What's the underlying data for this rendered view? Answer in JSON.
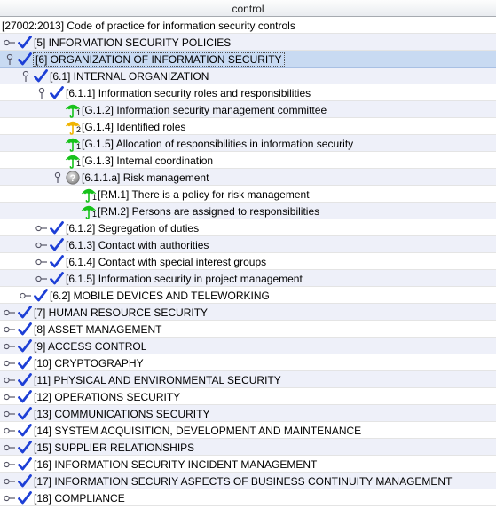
{
  "header": {
    "column_title": "control"
  },
  "root": {
    "label": "[27002:2013] Code of practice for information security controls"
  },
  "rows": [
    {
      "label": "[5] INFORMATION SECURITY POLICIES",
      "icon": "check-icon"
    },
    {
      "label": "[6] ORGANIZATION OF INFORMATION SECURITY",
      "icon": "check-icon"
    },
    {
      "label": "[6.1] INTERNAL ORGANIZATION",
      "icon": "check-icon"
    },
    {
      "label": "[6.1.1] Information security roles and responsibilities",
      "icon": "check-icon"
    },
    {
      "label": "[G.1.2] Information security management committee",
      "icon": "umbrella-green-icon",
      "badge": "1"
    },
    {
      "label": "[G.1.4] Identified roles",
      "icon": "umbrella-orange-icon",
      "badge": "2"
    },
    {
      "label": "[G.1.5] Allocation of responsibilities in information security",
      "icon": "umbrella-green-icon",
      "badge": "1"
    },
    {
      "label": "[G.1.3] Internal coordination",
      "icon": "umbrella-green-icon",
      "badge": "1"
    },
    {
      "label": "[6.1.1.a] Risk management",
      "icon": "question-icon"
    },
    {
      "label": "[RM.1] There is a policy for risk management",
      "icon": "umbrella-green-icon",
      "badge": "1"
    },
    {
      "label": "[RM.2] Persons are assigned to responsibilities",
      "icon": "umbrella-green-icon",
      "badge": "1"
    },
    {
      "label": "[6.1.2] Segregation of duties",
      "icon": "check-icon"
    },
    {
      "label": "[6.1.3] Contact with authorities",
      "icon": "check-icon"
    },
    {
      "label": "[6.1.4] Contact with special interest groups",
      "icon": "check-icon"
    },
    {
      "label": "[6.1.5] Information security in project management",
      "icon": "check-icon"
    },
    {
      "label": "[6.2] MOBILE DEVICES AND TELEWORKING",
      "icon": "check-icon"
    },
    {
      "label": "[7] HUMAN RESOURCE SECURITY",
      "icon": "check-icon"
    },
    {
      "label": "[8] ASSET MANAGEMENT",
      "icon": "check-icon"
    },
    {
      "label": "[9] ACCESS CONTROL",
      "icon": "check-icon"
    },
    {
      "label": "[10] CRYPTOGRAPHY",
      "icon": "check-icon"
    },
    {
      "label": "[11] PHYSICAL AND ENVIRONMENTAL SECURITY",
      "icon": "check-icon"
    },
    {
      "label": "[12] OPERATIONS SECURITY",
      "icon": "check-icon"
    },
    {
      "label": "[13] COMMUNICATIONS SECURITY",
      "icon": "check-icon"
    },
    {
      "label": "[14] SYSTEM ACQUISITION, DEVELOPMENT AND MAINTENANCE",
      "icon": "check-icon"
    },
    {
      "label": "[15] SUPPLIER RELATIONSHIPS",
      "icon": "check-icon"
    },
    {
      "label": "[16] INFORMATION SECURITY INCIDENT MANAGEMENT",
      "icon": "check-icon"
    },
    {
      "label": "[17] INFORMATION SECURIY ASPECTS OF BUSINESS CONTINUITY MANAGEMENT",
      "icon": "check-icon"
    },
    {
      "label": "[18] COMPLIANCE",
      "icon": "check-icon"
    }
  ],
  "colors": {
    "check": "#1d3fd6",
    "umbrella_green": "#17c21b",
    "umbrella_orange": "#f0b400",
    "selected_row": "#c8daf2",
    "alt_row": "#eef0f9"
  }
}
